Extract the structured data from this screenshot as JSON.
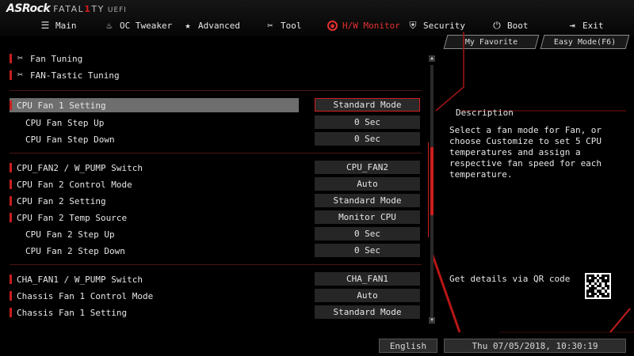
{
  "brand": {
    "asrock": "ASRock",
    "fatal": "FATAL",
    "one": "1",
    "ty": "TY",
    "uefi": "UEFI"
  },
  "nav": {
    "tabs": [
      {
        "label": "Main",
        "icon": "list-icon",
        "glyph": "☰",
        "active": false
      },
      {
        "label": "OC Tweaker",
        "icon": "flame-icon",
        "glyph": "🔥",
        "active": false
      },
      {
        "label": "Advanced",
        "icon": "star-icon",
        "glyph": "★",
        "active": false
      },
      {
        "label": "Tool",
        "icon": "tools-icon",
        "glyph": "✕",
        "active": false
      },
      {
        "label": "H/W Monitor",
        "icon": "monitor-icon",
        "glyph": "●",
        "active": true
      },
      {
        "label": "Security",
        "icon": "shield-icon",
        "glyph": "⛨",
        "active": false
      },
      {
        "label": "Boot",
        "icon": "power-icon",
        "glyph": "⏻",
        "active": false
      },
      {
        "label": "Exit",
        "icon": "exit-icon",
        "glyph": "⇥",
        "active": false
      }
    ]
  },
  "top_buttons": {
    "favorite": "My Favorite",
    "easy_mode": "Easy Mode(F6)"
  },
  "tools": [
    {
      "label": "Fan Tuning"
    },
    {
      "label": "FAN-Tastic Tuning"
    }
  ],
  "settings": [
    {
      "label": "CPU Fan 1 Setting",
      "value": "Standard Mode",
      "sub": false,
      "selected": true
    },
    {
      "label": "CPU Fan Step Up",
      "value": "0 Sec",
      "sub": true,
      "selected": false
    },
    {
      "label": "CPU Fan Step Down",
      "value": "0 Sec",
      "sub": true,
      "selected": false
    },
    {
      "label": "CPU_FAN2 / W_PUMP Switch",
      "value": "CPU_FAN2",
      "sub": false,
      "selected": false
    },
    {
      "label": "CPU Fan 2 Control Mode",
      "value": "Auto",
      "sub": false,
      "selected": false
    },
    {
      "label": "CPU Fan 2 Setting",
      "value": "Standard Mode",
      "sub": false,
      "selected": false
    },
    {
      "label": "CPU Fan 2 Temp Source",
      "value": "Monitor CPU",
      "sub": false,
      "selected": false
    },
    {
      "label": "CPU Fan 2 Step Up",
      "value": "0 Sec",
      "sub": true,
      "selected": false
    },
    {
      "label": "CPU Fan 2 Step Down",
      "value": "0 Sec",
      "sub": true,
      "selected": false
    },
    {
      "label": "CHA_FAN1 / W_PUMP Switch",
      "value": "CHA_FAN1",
      "sub": false,
      "selected": false
    },
    {
      "label": "Chassis Fan 1 Control Mode",
      "value": "Auto",
      "sub": false,
      "selected": false
    },
    {
      "label": "Chassis Fan 1 Setting",
      "value": "Standard Mode",
      "sub": false,
      "selected": false
    }
  ],
  "description": {
    "title": "Description",
    "text": "Select a fan mode for Fan, or choose Customize to set 5 CPU temperatures and assign a respective fan speed for each temperature.",
    "qr_text": "Get details via QR code"
  },
  "bottom": {
    "language": "English",
    "datetime": "Thu 07/05/2018, 10:30:19"
  },
  "colors": {
    "accent": "#d21e1e",
    "background": "#000000",
    "selected_row": "#6e6e6e"
  }
}
